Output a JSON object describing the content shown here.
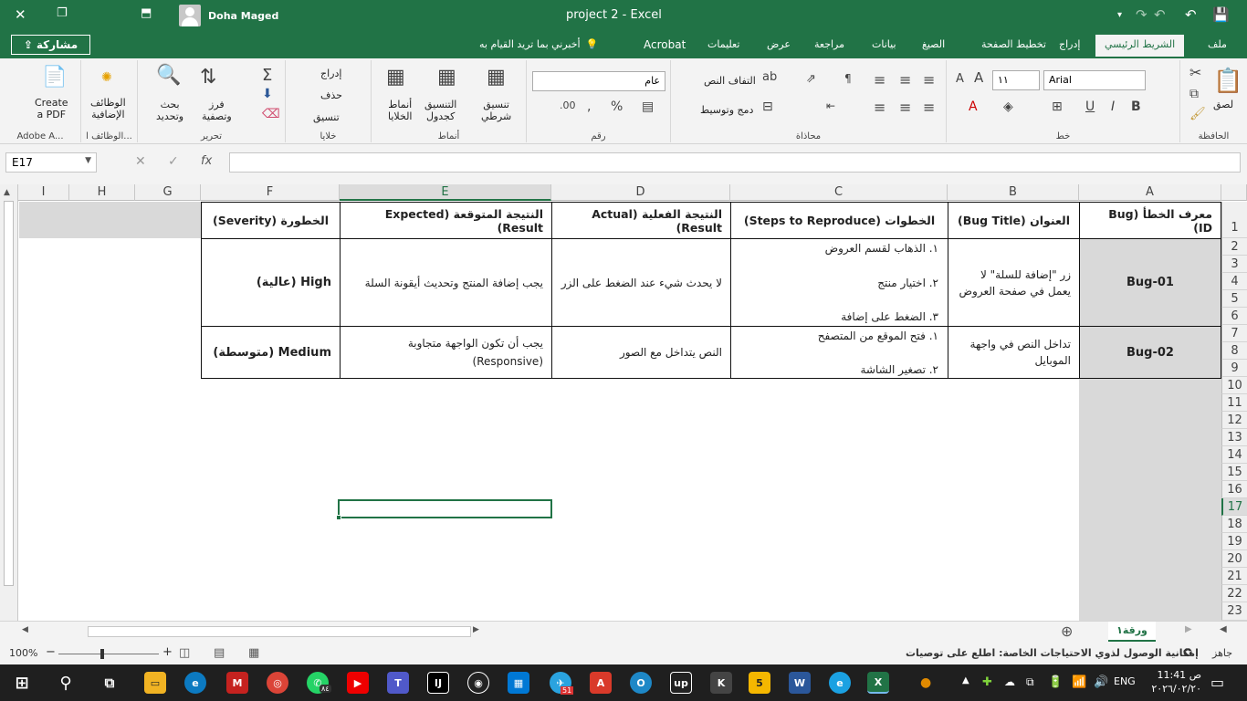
{
  "window": {
    "title": "project 2  -  Excel",
    "user_name": "Doha Maged"
  },
  "tabs": {
    "share_label": "مشاركة",
    "tell_me": "أخبرني بما تريد القيام به",
    "items": [
      "ملف",
      "الشريط الرئيسي",
      "إدراج",
      "تخطيط الصفحة",
      "الصيغ",
      "بيانات",
      "مراجعة",
      "عرض",
      "تعليمات",
      "Acrobat"
    ]
  },
  "ribbon": {
    "clipboard": {
      "group": "الحافظة",
      "paste": "لصق"
    },
    "font": {
      "group": "خط",
      "font_name": "Arial",
      "font_size": "١١"
    },
    "alignment": {
      "group": "محاذاة",
      "wrap_text": "التفاف النص",
      "merge": "دمج وتوسيط"
    },
    "number": {
      "group": "رقم",
      "format": "عام"
    },
    "styles": {
      "group": "أنماط",
      "conditional": "تنسيق\nشرطي",
      "as_table": "التنسيق\nكجدول",
      "cell_styles": "أنماط\nالخلايا"
    },
    "cells": {
      "group": "خلايا",
      "insert": "إدراج",
      "delete": "حذف",
      "format": "تنسيق"
    },
    "editing": {
      "group": "تحرير",
      "sort": "فرز\nوتصفية",
      "find": "بحث\nوتحديد"
    },
    "addins": {
      "group": "الوظائف ا...",
      "label": "الوظائف\nالإضافية"
    },
    "adobe": {
      "group": "Adobe A...",
      "label": "Create\na PDF"
    }
  },
  "formula_bar": {
    "name_box": "E17",
    "fx": "fx",
    "value": ""
  },
  "columns": [
    "A",
    "B",
    "C",
    "D",
    "E",
    "F",
    "G",
    "H",
    "I"
  ],
  "rows": [
    "1",
    "2",
    "3",
    "4",
    "5",
    "6",
    "7",
    "8",
    "9",
    "10",
    "11",
    "12",
    "13",
    "14",
    "15",
    "16",
    "17",
    "18",
    "19",
    "20",
    "21",
    "22",
    "23"
  ],
  "table": {
    "headers": {
      "a": "معرف الخطأ (Bug ID)",
      "b": "العنوان (Bug Title)",
      "c": "الخطوات (Steps to Reproduce)",
      "d": "النتيجة الفعلية (Actual Result)",
      "e": "النتيجة المتوقعة (Expected Result)",
      "f": "الخطورة (Severity)"
    },
    "row1": {
      "id": "Bug-01",
      "title": "زر \"إضافة للسلة\" لا يعمل في صفحة العروض",
      "step1": "١. الذهاب لقسم العروض",
      "step2": "٢. اختيار منتج",
      "step3": "٣. الضغط على إضافة",
      "actual": "لا يحدث شيء عند الضغط على الزر",
      "expected": "يجب إضافة المنتج وتحديث أيقونة السلة",
      "severity": "High (عالية)"
    },
    "row2": {
      "id": "Bug-02",
      "title": "تداخل النص في واجهة الموبايل",
      "step1": "١. فتح الموقع من المتصفح",
      "step2": "٢. تصغير الشاشة",
      "actual": "النص يتداخل مع الصور",
      "expected": "يجب أن تكون الواجهة متجاوبة (Responsive)",
      "severity": "Medium (متوسطة)"
    }
  },
  "sheet": {
    "tab_name": "ورقة١"
  },
  "status": {
    "ready": "جاهز",
    "accessibility": "إمكانية الوصول لذوي الاحتياجات الخاصة: اطلع على توصيات",
    "zoom": "100%"
  },
  "taskbar": {
    "time": "11:41 ص",
    "date": "٢٠٢٦/٠٢/٢٠",
    "lang": "ENG",
    "badge_whatsapp": "٨٤",
    "badge_telegram": "51"
  },
  "colors": {
    "excel_green": "#217346"
  }
}
